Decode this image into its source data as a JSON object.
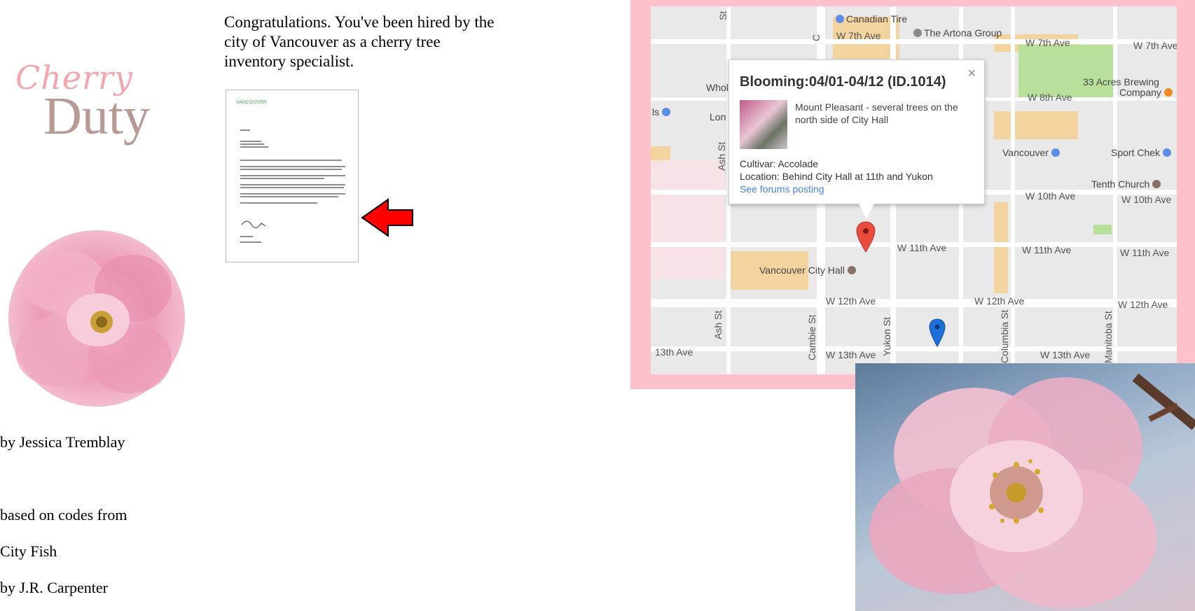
{
  "logo": {
    "cherry": "Cherry",
    "duty": "Duty"
  },
  "credits": {
    "author": "by Jessica Tremblay",
    "based_on": "based on codes from",
    "source_title": "City Fish",
    "source_author": "by J.R. Carpenter"
  },
  "intro": "Congratulations. You've been hired by the city of Vancouver as a cherry tree inventory specialist.",
  "letter": {
    "logo_text": "VANCOUVER"
  },
  "map": {
    "info": {
      "title": "Blooming:04/01-04/12 (ID.1014)",
      "close": "×",
      "description": "Mount Pleasant - several trees on the north side of City Hall",
      "cultivar": "Cultivar: Accolade",
      "location": "Location: Behind City Hall at 11th and Yukon",
      "link": "See forums posting"
    },
    "streets": {
      "w7th_a": "W 7th Ave",
      "w7th_b": "W 7th Ave",
      "w7th_c": "W 7th Ave",
      "w8th": "W 8th Ave",
      "w10th_a": "W 10th Ave",
      "w10th_b": "W 10th Ave",
      "w11th_a": "W 11th Ave",
      "w11th_b": "W 11th Ave",
      "w11th_c": "W 11th Ave",
      "w12th_a": "W 12th Ave",
      "w12th_b": "W 12th Ave",
      "w12th_c": "W 12th Ave",
      "w13th_a": "13th Ave",
      "w13th_b": "W 13th Ave",
      "w13th_c": "W 13th Ave",
      "ash_a": "Ash St",
      "ash_b": "Ash St",
      "cambie": "Cambie St",
      "yukon": "Yukon St",
      "columbia": "Columbia St",
      "manitoba": "Manitoba St",
      "st_top": "St",
      "c_top": "C"
    },
    "pois": {
      "canadian_tire": "Canadian Tire",
      "artona": "The Artona Group",
      "acres": "33 Acres Brewing",
      "acres2": "Company",
      "vancouver": "Vancouver",
      "sport_chek": "Sport Chek",
      "tenth_church": "Tenth Church",
      "city_hall": "Vancouver City Hall",
      "whol": "Whol",
      "lon": "Lon",
      "ls": "ls"
    },
    "colors": {
      "pin_red": "#e74c3c",
      "pin_blue": "#1e6fd9"
    }
  },
  "colors": {
    "frame": "#fdc1cc",
    "logo_cherry": "#f3a6ad",
    "logo_duty": "#b79a93",
    "arrow": "#ff0000"
  }
}
